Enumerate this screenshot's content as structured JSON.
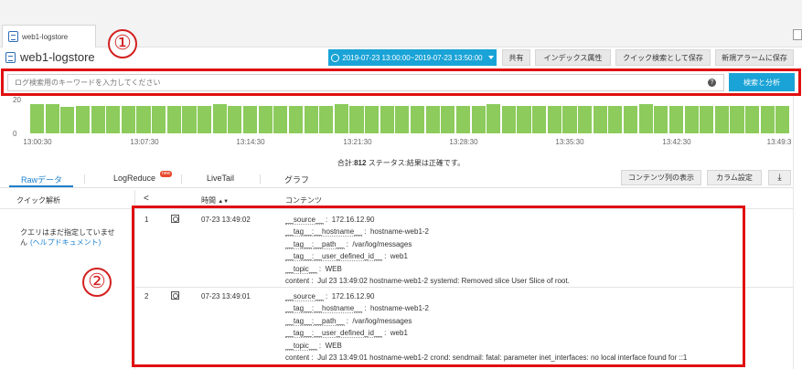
{
  "tab": {
    "label": "web1-logstore"
  },
  "annotations": {
    "one": "①",
    "two": "②"
  },
  "title": "web1-logstore",
  "toolbar": {
    "time_range": "2019-07-23 13:00:00~2019-07-23 13:50:00",
    "share": "共有",
    "index_attr": "インデックス属性",
    "save_quick_search": "クイック検索として保存",
    "save_alarm": "新規アラームに保存"
  },
  "search": {
    "placeholder": "ログ検索用のキーワードを入力してください",
    "button": "検索と分析",
    "help": "?"
  },
  "histogram": {
    "y_max": "20",
    "y_min": "0",
    "x_ticks": [
      "13:00:30",
      "13:07:30",
      "13:14:30",
      "13:21:30",
      "13:28:30",
      "13:35:30",
      "13:42:30",
      "13:49:3"
    ],
    "levels": [
      1,
      1,
      0.9,
      0.93,
      0.93,
      0.93,
      0.93,
      0.93,
      0.93,
      0.93,
      0.93,
      0.93,
      1,
      0.93,
      0.93,
      0.93,
      0.93,
      0.93,
      0.93,
      0.93,
      1,
      0.93,
      0.93,
      0.93,
      0.93,
      0.93,
      0.93,
      0.93,
      0.93,
      0.93,
      1,
      0.93,
      0.93,
      0.93,
      0.93,
      0.93,
      0.93,
      0.93,
      0.93,
      0.93,
      1,
      0.93,
      0.93,
      0.93,
      0.93,
      0.93,
      0.93,
      0.93,
      0.93,
      0.93
    ],
    "summary_prefix": "合計:",
    "total": "812",
    "summary_suffix": " ステータス:結果は正確です。"
  },
  "subtabs": {
    "raw": "Rawデータ",
    "logreduce": "LogReduce",
    "new_badge": "new",
    "livetail": "LiveTail",
    "graph": "グラフ",
    "content_display": "コンテンツ列の表示",
    "column_settings": "カラム設定",
    "download_icon": "download-icon"
  },
  "table": {
    "quick_analysis": "クイック解析",
    "collapse": "<",
    "time_header": "時間",
    "sort_icon": "▲▼",
    "content_header": "コンテンツ",
    "no_query_line1": "クエリはまだ指定していませ",
    "no_query_line2": "ん",
    "help_doc": "(ヘルプドキュメント)"
  },
  "logs": [
    {
      "num": "1",
      "time": "07-23 13:49:02",
      "fields": [
        {
          "k": "__source__",
          "v": "172.16.12.90"
        },
        {
          "k": "__tag__:__hostname__",
          "v": "hostname-web1-2"
        },
        {
          "k": "__tag__:__path__",
          "v": "/var/log/messages"
        },
        {
          "k": "__tag__:__user_defined_id__",
          "v": "web1"
        },
        {
          "k": "__topic__",
          "v": "WEB"
        },
        {
          "k": "content",
          "v": "Jul 23 13:49:02 hostname-web1-2 systemd: Removed slice User Slice of root."
        }
      ]
    },
    {
      "num": "2",
      "time": "07-23 13:49:01",
      "fields": [
        {
          "k": "__source__",
          "v": "172.16.12.90"
        },
        {
          "k": "__tag__:__hostname__",
          "v": "hostname-web1-2"
        },
        {
          "k": "__tag__:__path__",
          "v": "/var/log/messages"
        },
        {
          "k": "__tag__:__user_defined_id__",
          "v": "web1"
        },
        {
          "k": "__topic__",
          "v": "WEB"
        },
        {
          "k": "content",
          "v": "Jul 23 13:49:01 hostname-web1-2 crond: sendmail: fatal: parameter inet_interfaces: no local interface found for ::1"
        }
      ]
    }
  ],
  "colors": {
    "accent": "#1aa3d6",
    "bar": "#8ccb5c",
    "highlight": "#e01010"
  }
}
